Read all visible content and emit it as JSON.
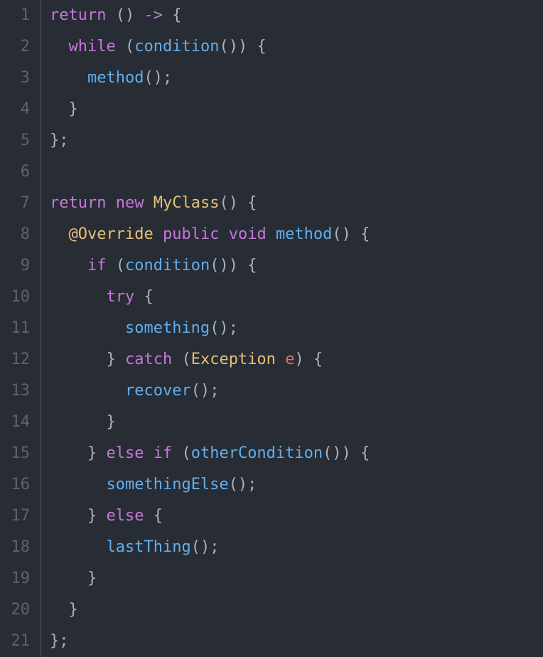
{
  "lines": [
    {
      "n": "1",
      "tokens": [
        [
          "tk-keyword",
          "return"
        ],
        [
          "tk-plain",
          " "
        ],
        [
          "tk-punct",
          "()"
        ],
        [
          "tk-plain",
          " "
        ],
        [
          "tk-arrow",
          "->"
        ],
        [
          "tk-plain",
          " "
        ],
        [
          "tk-punct",
          "{"
        ]
      ]
    },
    {
      "n": "2",
      "tokens": [
        [
          "tk-plain",
          "  "
        ],
        [
          "tk-keyword",
          "while"
        ],
        [
          "tk-plain",
          " "
        ],
        [
          "tk-punct",
          "("
        ],
        [
          "tk-func",
          "condition"
        ],
        [
          "tk-punct",
          "()"
        ],
        [
          "tk-punct",
          ")"
        ],
        [
          "tk-plain",
          " "
        ],
        [
          "tk-punct",
          "{"
        ]
      ]
    },
    {
      "n": "3",
      "tokens": [
        [
          "tk-plain",
          "    "
        ],
        [
          "tk-func",
          "method"
        ],
        [
          "tk-punct",
          "()"
        ],
        [
          "tk-punct",
          ";"
        ]
      ]
    },
    {
      "n": "4",
      "tokens": [
        [
          "tk-plain",
          "  "
        ],
        [
          "tk-punct",
          "}"
        ]
      ]
    },
    {
      "n": "5",
      "tokens": [
        [
          "tk-punct",
          "};"
        ]
      ]
    },
    {
      "n": "6",
      "tokens": []
    },
    {
      "n": "7",
      "tokens": [
        [
          "tk-keyword",
          "return"
        ],
        [
          "tk-plain",
          " "
        ],
        [
          "tk-keyword",
          "new"
        ],
        [
          "tk-plain",
          " "
        ],
        [
          "tk-type",
          "MyClass"
        ],
        [
          "tk-punct",
          "()"
        ],
        [
          "tk-plain",
          " "
        ],
        [
          "tk-punct",
          "{"
        ]
      ]
    },
    {
      "n": "8",
      "tokens": [
        [
          "tk-plain",
          "  "
        ],
        [
          "tk-annot",
          "@Override"
        ],
        [
          "tk-plain",
          " "
        ],
        [
          "tk-keyword",
          "public"
        ],
        [
          "tk-plain",
          " "
        ],
        [
          "tk-keyword",
          "void"
        ],
        [
          "tk-plain",
          " "
        ],
        [
          "tk-func",
          "method"
        ],
        [
          "tk-punct",
          "()"
        ],
        [
          "tk-plain",
          " "
        ],
        [
          "tk-punct",
          "{"
        ]
      ]
    },
    {
      "n": "9",
      "tokens": [
        [
          "tk-plain",
          "    "
        ],
        [
          "tk-keyword",
          "if"
        ],
        [
          "tk-plain",
          " "
        ],
        [
          "tk-punct",
          "("
        ],
        [
          "tk-func",
          "condition"
        ],
        [
          "tk-punct",
          "()"
        ],
        [
          "tk-punct",
          ")"
        ],
        [
          "tk-plain",
          " "
        ],
        [
          "tk-punct",
          "{"
        ]
      ]
    },
    {
      "n": "10",
      "tokens": [
        [
          "tk-plain",
          "      "
        ],
        [
          "tk-keyword",
          "try"
        ],
        [
          "tk-plain",
          " "
        ],
        [
          "tk-punct",
          "{"
        ]
      ]
    },
    {
      "n": "11",
      "tokens": [
        [
          "tk-plain",
          "        "
        ],
        [
          "tk-func",
          "something"
        ],
        [
          "tk-punct",
          "()"
        ],
        [
          "tk-punct",
          ";"
        ]
      ]
    },
    {
      "n": "12",
      "tokens": [
        [
          "tk-plain",
          "      "
        ],
        [
          "tk-punct",
          "}"
        ],
        [
          "tk-plain",
          " "
        ],
        [
          "tk-keyword",
          "catch"
        ],
        [
          "tk-plain",
          " "
        ],
        [
          "tk-punct",
          "("
        ],
        [
          "tk-type",
          "Exception"
        ],
        [
          "tk-plain",
          " "
        ],
        [
          "tk-param",
          "e"
        ],
        [
          "tk-punct",
          ")"
        ],
        [
          "tk-plain",
          " "
        ],
        [
          "tk-punct",
          "{"
        ]
      ]
    },
    {
      "n": "13",
      "tokens": [
        [
          "tk-plain",
          "        "
        ],
        [
          "tk-func",
          "recover"
        ],
        [
          "tk-punct",
          "()"
        ],
        [
          "tk-punct",
          ";"
        ]
      ]
    },
    {
      "n": "14",
      "tokens": [
        [
          "tk-plain",
          "      "
        ],
        [
          "tk-punct",
          "}"
        ]
      ]
    },
    {
      "n": "15",
      "tokens": [
        [
          "tk-plain",
          "    "
        ],
        [
          "tk-punct",
          "}"
        ],
        [
          "tk-plain",
          " "
        ],
        [
          "tk-keyword",
          "else"
        ],
        [
          "tk-plain",
          " "
        ],
        [
          "tk-keyword",
          "if"
        ],
        [
          "tk-plain",
          " "
        ],
        [
          "tk-punct",
          "("
        ],
        [
          "tk-func",
          "otherCondition"
        ],
        [
          "tk-punct",
          "()"
        ],
        [
          "tk-punct",
          ")"
        ],
        [
          "tk-plain",
          " "
        ],
        [
          "tk-punct",
          "{"
        ]
      ]
    },
    {
      "n": "16",
      "tokens": [
        [
          "tk-plain",
          "      "
        ],
        [
          "tk-func",
          "somethingElse"
        ],
        [
          "tk-punct",
          "()"
        ],
        [
          "tk-punct",
          ";"
        ]
      ]
    },
    {
      "n": "17",
      "tokens": [
        [
          "tk-plain",
          "    "
        ],
        [
          "tk-punct",
          "}"
        ],
        [
          "tk-plain",
          " "
        ],
        [
          "tk-keyword",
          "else"
        ],
        [
          "tk-plain",
          " "
        ],
        [
          "tk-punct",
          "{"
        ]
      ]
    },
    {
      "n": "18",
      "tokens": [
        [
          "tk-plain",
          "      "
        ],
        [
          "tk-func",
          "lastThing"
        ],
        [
          "tk-punct",
          "()"
        ],
        [
          "tk-punct",
          ";"
        ]
      ]
    },
    {
      "n": "19",
      "tokens": [
        [
          "tk-plain",
          "    "
        ],
        [
          "tk-punct",
          "}"
        ]
      ]
    },
    {
      "n": "20",
      "tokens": [
        [
          "tk-plain",
          "  "
        ],
        [
          "tk-punct",
          "}"
        ]
      ]
    },
    {
      "n": "21",
      "tokens": [
        [
          "tk-punct",
          "};"
        ]
      ]
    }
  ]
}
